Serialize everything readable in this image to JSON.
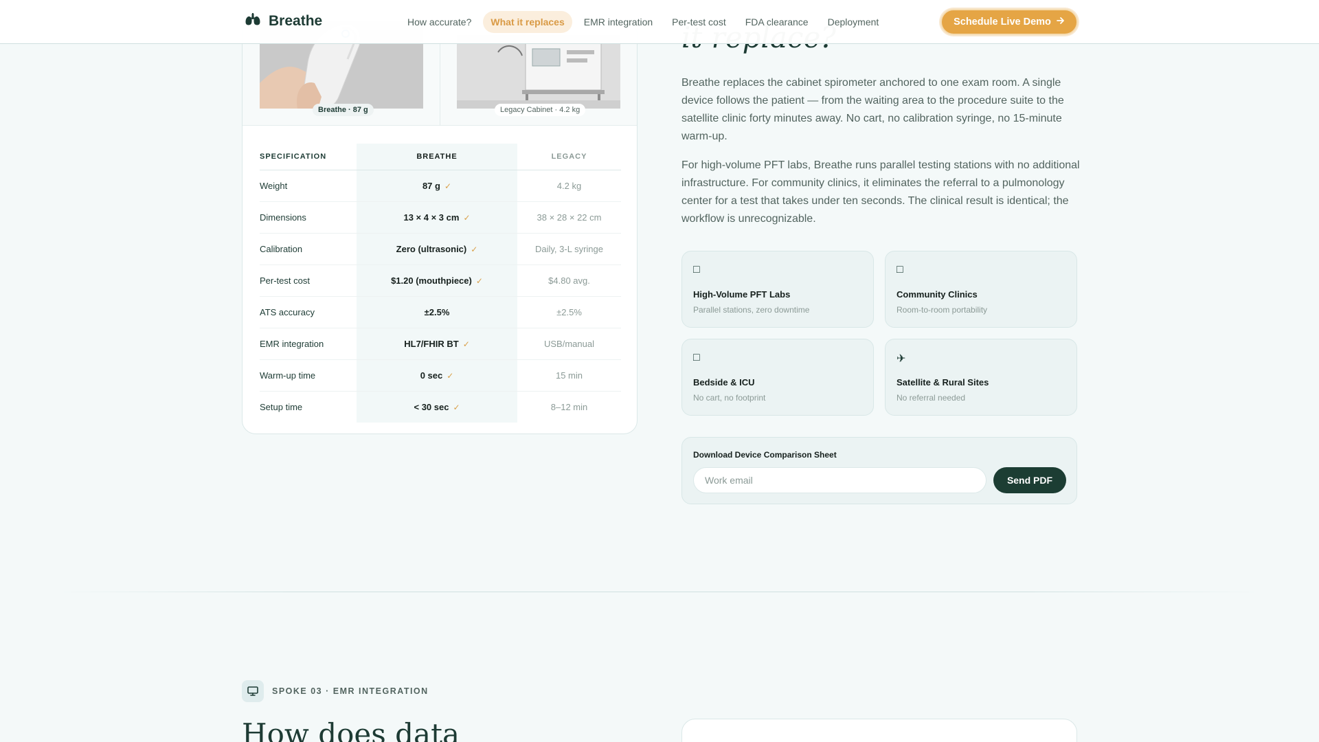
{
  "nav": {
    "brand": "Breathe",
    "links": [
      "How accurate?",
      "What it replaces",
      "EMR integration",
      "Per-test cost",
      "FDA clearance",
      "Deployment"
    ],
    "active_index": 1,
    "cta": "Schedule Live Demo"
  },
  "photos": {
    "breathe_caption": "Breathe · 87 g",
    "legacy_caption": "Legacy Cabinet · 4.2 kg"
  },
  "table": {
    "headers": [
      "SPECIFICATION",
      "BREATHE",
      "LEGACY"
    ],
    "rows": [
      {
        "spec": "Weight",
        "breathe": "87 g",
        "check": true,
        "legacy": "4.2 kg"
      },
      {
        "spec": "Dimensions",
        "breathe": "13 × 4 × 3 cm",
        "check": true,
        "legacy": "38 × 28 × 22 cm"
      },
      {
        "spec": "Calibration",
        "breathe": "Zero (ultrasonic)",
        "check": true,
        "legacy": "Daily, 3-L syringe"
      },
      {
        "spec": "Per-test cost",
        "breathe": "$1.20 (mouthpiece)",
        "check": true,
        "legacy": "$4.80 avg."
      },
      {
        "spec": "ATS accuracy",
        "breathe": "±2.5%",
        "check": false,
        "legacy": "±2.5%"
      },
      {
        "spec": "EMR integration",
        "breathe": "HL7/FHIR BT",
        "check": true,
        "legacy": "USB/manual"
      },
      {
        "spec": "Warm-up time",
        "breathe": "0 sec",
        "check": true,
        "legacy": "15 min"
      },
      {
        "spec": "Setup time",
        "breathe": "< 30 sec",
        "check": true,
        "legacy": "8–12 min"
      }
    ]
  },
  "right": {
    "heading": "it replace?",
    "para1": "Breathe replaces the cabinet spirometer anchored to one exam room. A single device follows the patient — from the waiting area to the procedure suite to the satellite clinic forty minutes away. No cart, no calibration syringe, no 15-minute warm-up.",
    "para2": "For high-volume PFT labs, Breathe runs parallel testing stations with no additional infrastructure. For community clinics, it eliminates the referral to a pulmonology center for a test that takes under ten seconds. The clinical result is identical; the workflow is unrecognizable.",
    "features": [
      {
        "icon": "□",
        "title": "High-Volume PFT Labs",
        "sub": "Parallel stations, zero downtime"
      },
      {
        "icon": "□",
        "title": "Community Clinics",
        "sub": "Room-to-room portability"
      },
      {
        "icon": "□",
        "title": "Bedside & ICU",
        "sub": "No cart, no footprint"
      },
      {
        "icon": "✈",
        "title": "Satellite & Rural Sites",
        "sub": "No referral needed"
      }
    ]
  },
  "download": {
    "title": "Download Device Comparison Sheet",
    "placeholder": "Work email",
    "button": "Send PDF"
  },
  "spoke": {
    "label": "SPOKE 03 · EMR INTEGRATION",
    "heading": "How does data"
  },
  "colors": {
    "accent": "#e5a545",
    "dark": "#1c3d33",
    "check": "#d9a04a"
  }
}
